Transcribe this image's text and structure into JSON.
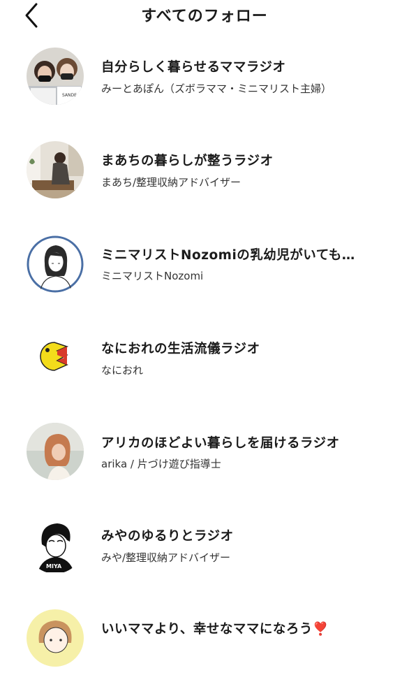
{
  "header": {
    "title": "すべてのフォロー"
  },
  "follows": [
    {
      "name": "自分らしく暮らせるママラジオ",
      "author": "みーとあぽん（ズボラママ・ミニマリスト主婦）",
      "avatar": "mom-duo-photo"
    },
    {
      "name": "まあちの暮らしが整うラジオ",
      "author": "まあち/整理収納アドバイザー",
      "avatar": "living-room-photo"
    },
    {
      "name": "ミニマリストNozomiの乳幼児がいても…",
      "author": "ミニマリストNozomi",
      "avatar": "line-drawing-portrait"
    },
    {
      "name": "なにおれの生活流儀ラジオ",
      "author": "なにおれ",
      "avatar": "yellow-chomper-illustration"
    },
    {
      "name": "アリカのほどよい暮らしを届けるラジオ",
      "author": "arika / 片づけ遊び指導士",
      "avatar": "woman-profile-photo"
    },
    {
      "name": "みやのゆるりとラジオ",
      "author": "みや/整理収納アドバイザー",
      "avatar": "miya-illustration"
    },
    {
      "name": "いいママより、幸せなママになろう",
      "author": "",
      "avatar": "mom-illustration"
    }
  ],
  "extras": {
    "heart_emoji": "❣️"
  }
}
